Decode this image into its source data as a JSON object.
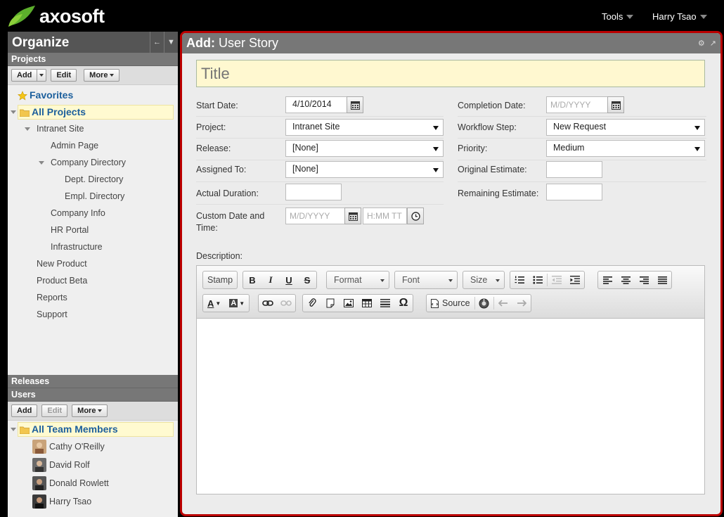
{
  "app": {
    "brand": "axosoft"
  },
  "topnav": {
    "tools_label": "Tools",
    "user_label": "Harry Tsao"
  },
  "sidebar": {
    "title": "Organize",
    "projects_header": "Projects",
    "projects_toolbar": {
      "add": "Add",
      "edit": "Edit",
      "more": "More"
    },
    "favorites": "Favorites",
    "all_projects": "All Projects",
    "tree": [
      "Intranet Site",
      "Admin Page",
      "Company Directory",
      "Dept. Directory",
      "Empl. Directory",
      "Company Info",
      "HR Portal",
      "Infrastructure",
      "New Product",
      "Product Beta",
      "Reports",
      "Support"
    ],
    "releases_header": "Releases",
    "users_header": "Users",
    "users_toolbar": {
      "add": "Add",
      "edit": "Edit",
      "more": "More"
    },
    "all_team_members": "All Team Members",
    "users": [
      "Cathy O'Reilly",
      "David Rolf",
      "Donald Rowlett",
      "Harry Tsao"
    ]
  },
  "panel": {
    "title_prefix": "Add:",
    "title_text": "User Story",
    "title_placeholder": "Title"
  },
  "form": {
    "start_date_label": "Start Date:",
    "start_date_value": "4/10/2014",
    "project_label": "Project:",
    "project_value": "Intranet Site",
    "release_label": "Release:",
    "release_value": "[None]",
    "assigned_label": "Assigned To:",
    "assigned_value": "[None]",
    "actual_duration_label": "Actual Duration:",
    "custom_date_label": "Custom Date and Time:",
    "custom_date_placeholder": "M/D/YYYY",
    "custom_time_placeholder": "H:MM TT",
    "completion_date_label": "Completion Date:",
    "completion_date_placeholder": "M/D/YYYY",
    "workflow_label": "Workflow Step:",
    "workflow_value": "New Request",
    "priority_label": "Priority:",
    "priority_value": "Medium",
    "original_estimate_label": "Original Estimate:",
    "remaining_estimate_label": "Remaining Estimate:",
    "description_label": "Description:"
  },
  "editor": {
    "stamp": "Stamp",
    "bold": "B",
    "italic": "I",
    "underline": "U",
    "strike": "S",
    "format": "Format",
    "font": "Font",
    "size": "Size",
    "source": "Source",
    "omega": "Ω"
  },
  "colors": {
    "accent_border": "#b00000",
    "folder_selected": "#fffad0",
    "link_blue": "#1c5f9c"
  }
}
